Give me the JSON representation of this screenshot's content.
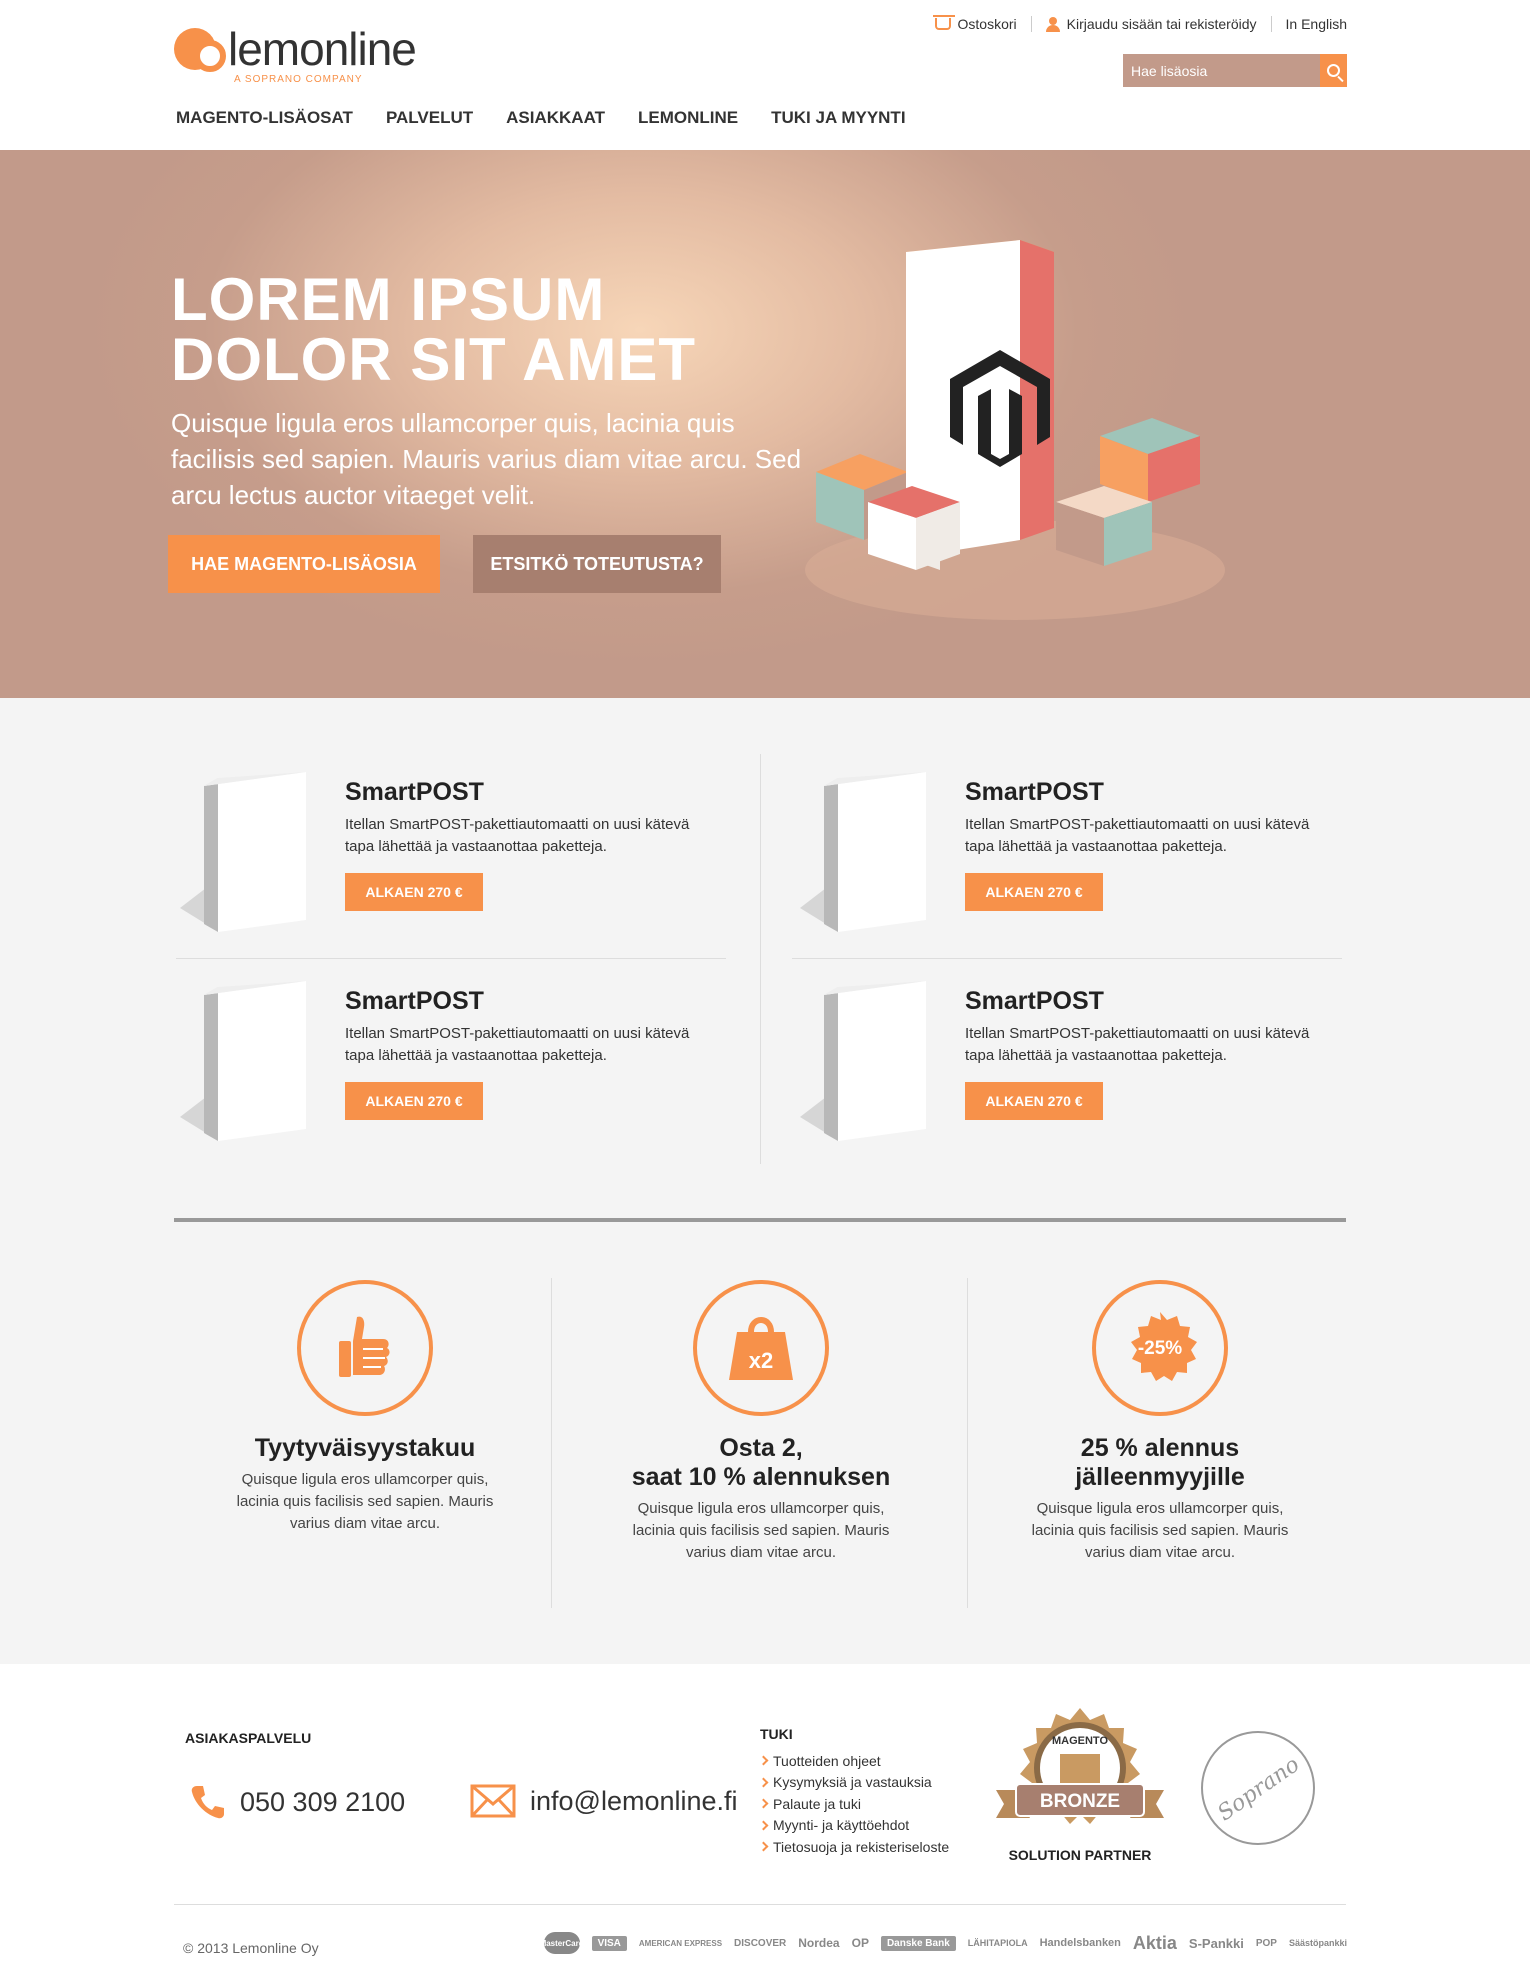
{
  "brand": {
    "name": "lemonline",
    "tagline": "A SOPRANO COMPANY",
    "accent": "#f7914a",
    "secondary": "#c29a8a"
  },
  "toplinks": {
    "cart": "Ostoskori",
    "login": "Kirjaudu sisään tai rekisteröidy",
    "lang": "In English"
  },
  "search": {
    "placeholder": "Hae lisäosia",
    "icon": "search-icon"
  },
  "nav": [
    "MAGENTO-LISÄOSAT",
    "PALVELUT",
    "ASIAKKAAT",
    "LEMONLINE",
    "TUKI JA MYYNTI"
  ],
  "hero": {
    "title": "LOREM IPSUM\nDOLOR SIT AMET",
    "text": "Quisque ligula eros ullamcorper quis, lacinia quis facilisis sed sapien. Mauris varius diam vitae arcu. Sed arcu lectus auctor vitaeget velit.",
    "btn_primary": "HAE MAGENTO-LISÄOSIA",
    "btn_secondary": "ETSITKÖ TOTEUTUSTA?"
  },
  "products": [
    {
      "title": "SmartPOST",
      "desc": "Itellan SmartPOST-pakettiautomaatti on uusi kätevä tapa lähettää ja vastaanottaa paketteja.",
      "price": "ALKAEN 270 €"
    },
    {
      "title": "SmartPOST",
      "desc": "Itellan SmartPOST-pakettiautomaatti on uusi kätevä tapa lähettää ja vastaanottaa paketteja.",
      "price": "ALKAEN 270 €"
    },
    {
      "title": "SmartPOST",
      "desc": "Itellan SmartPOST-pakettiautomaatti on uusi kätevä tapa lähettää ja vastaanottaa paketteja.",
      "price": "ALKAEN 270 €"
    },
    {
      "title": "SmartPOST",
      "desc": "Itellan SmartPOST-pakettiautomaatti on uusi kätevä tapa lähettää ja vastaanottaa paketteja.",
      "price": "ALKAEN 270 €"
    }
  ],
  "features": [
    {
      "icon": "thumbs-up-icon",
      "title": "Tyytyväisyystakuu",
      "text": "Quisque ligula eros ullamcorper quis, lacinia quis facilisis sed sapien. Mauris varius diam vitae arcu."
    },
    {
      "icon": "shopping-bag-icon",
      "badge": "x2",
      "title": "Osta 2,\nsaat 10 % alennuksen",
      "text": "Quisque ligula eros ullamcorper quis, lacinia quis facilisis sed sapien. Mauris varius diam vitae arcu."
    },
    {
      "icon": "discount-seal-icon",
      "badge": "-25%",
      "title": "25 % alennus\njälleenmyyjille",
      "text": "Quisque ligula eros ullamcorper quis, lacinia quis facilisis sed sapien. Mauris varius diam vitae arcu."
    }
  ],
  "footer": {
    "service_heading": "ASIAKASPALVELU",
    "phone": "050 309 2100",
    "email": "info@lemonline.fi",
    "support_heading": "TUKI",
    "support_links": [
      "Tuotteiden ohjeet",
      "Kysymyksiä ja vastauksia",
      "Palaute ja tuki",
      "Myynti- ja käyttöehdot",
      "Tietosuoja ja rekisteriseloste"
    ],
    "badge_top": "MAGENTO",
    "badge_main": "BRONZE",
    "badge_caption": "SOLUTION PARTNER",
    "sopr_logo": "Soprano",
    "copyright": "© 2013 Lemonline Oy",
    "payments": [
      "MasterCard",
      "VISA",
      "AMERICAN EXPRESS",
      "DISCOVER",
      "Nordea",
      "OP",
      "Danske Bank",
      "LÄHITAPIOLA",
      "Handelsbanken",
      "Aktia",
      "S-Pankki",
      "POP",
      "Säästöpankki"
    ]
  }
}
